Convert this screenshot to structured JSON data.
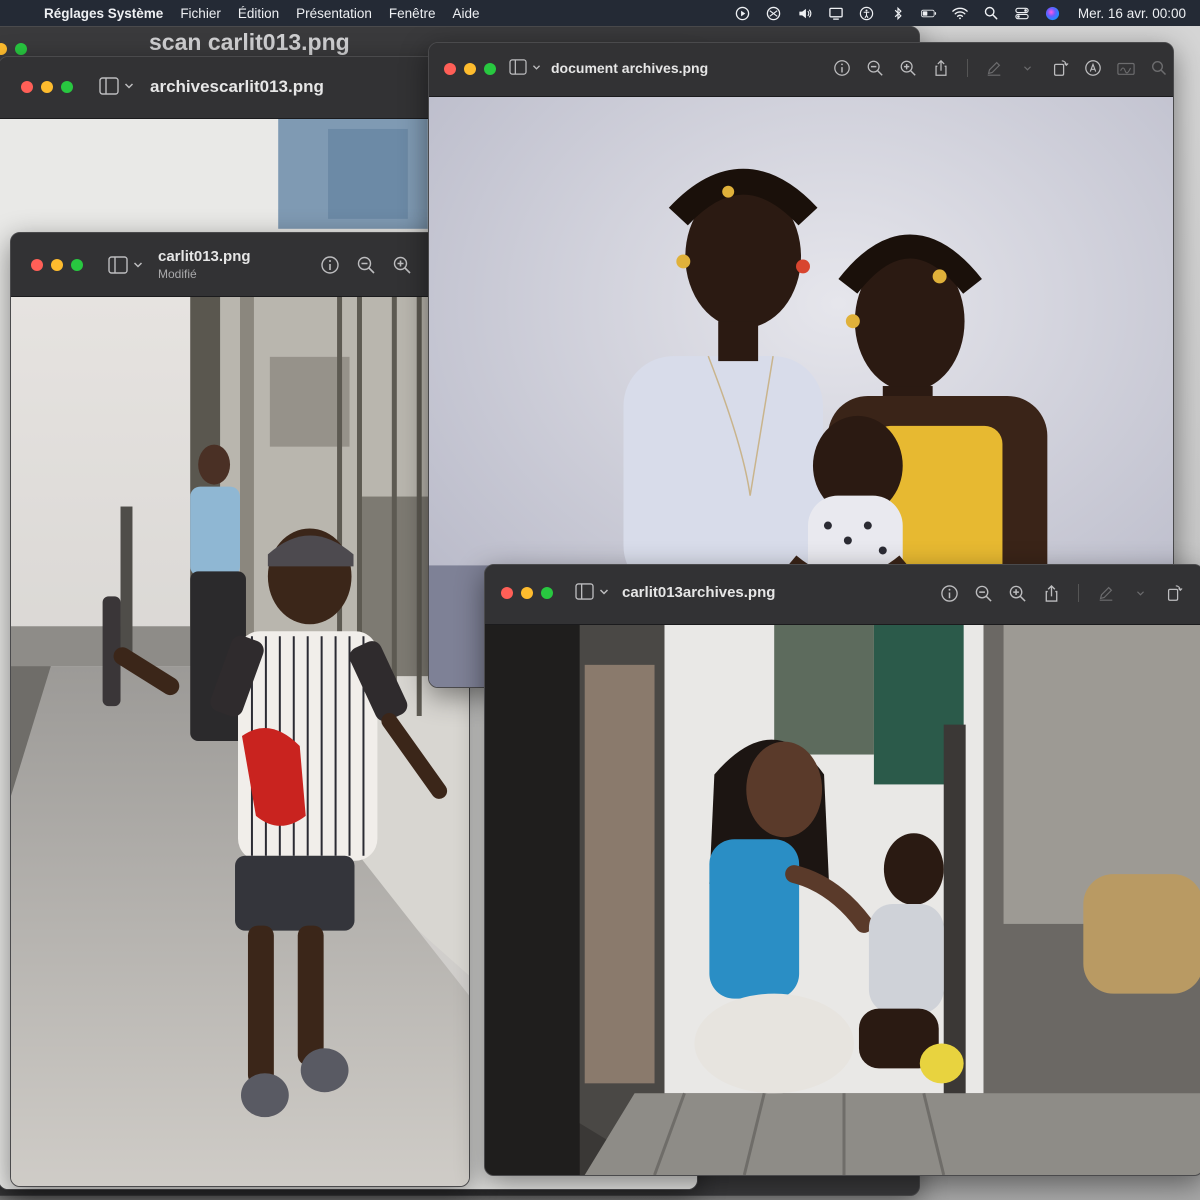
{
  "menubar": {
    "app_name": "Réglages Système",
    "menus": [
      "Fichier",
      "Édition",
      "Présentation",
      "Fenêtre",
      "Aide"
    ],
    "clock": "Mer. 16 avr.  00:00",
    "status_icons": [
      "moon-icon",
      "play-circle-icon",
      "screen-mirror-icon",
      "volume-icon",
      "display-icon",
      "accessibility-icon",
      "bluetooth-icon",
      "battery-icon",
      "wifi-icon",
      "search-icon",
      "control-center-icon",
      "siri-icon"
    ]
  },
  "windows": {
    "scan": {
      "title": "scan carlit013.png"
    },
    "archives": {
      "title": "archivescarlit013.png"
    },
    "carlit": {
      "title": "carlit013.png",
      "subtitle": "Modifié"
    },
    "document": {
      "title": "document archives.png"
    },
    "archives2": {
      "title": "carlit013archives.png"
    }
  },
  "photos": {
    "street": "child walking on sidewalk in striped baseball jersey, woman in blue top behind",
    "portrait": "two girls with beaded braids holding a baby",
    "doorway": "woman in blue top and child seated on floor in sunlit doorway"
  },
  "colors": {
    "menubar_bg": "#242a35",
    "window_bg": "#2b2b2d",
    "traffic_red": "#ff5f57",
    "traffic_yellow": "#febc2e",
    "traffic_green": "#28c840"
  }
}
